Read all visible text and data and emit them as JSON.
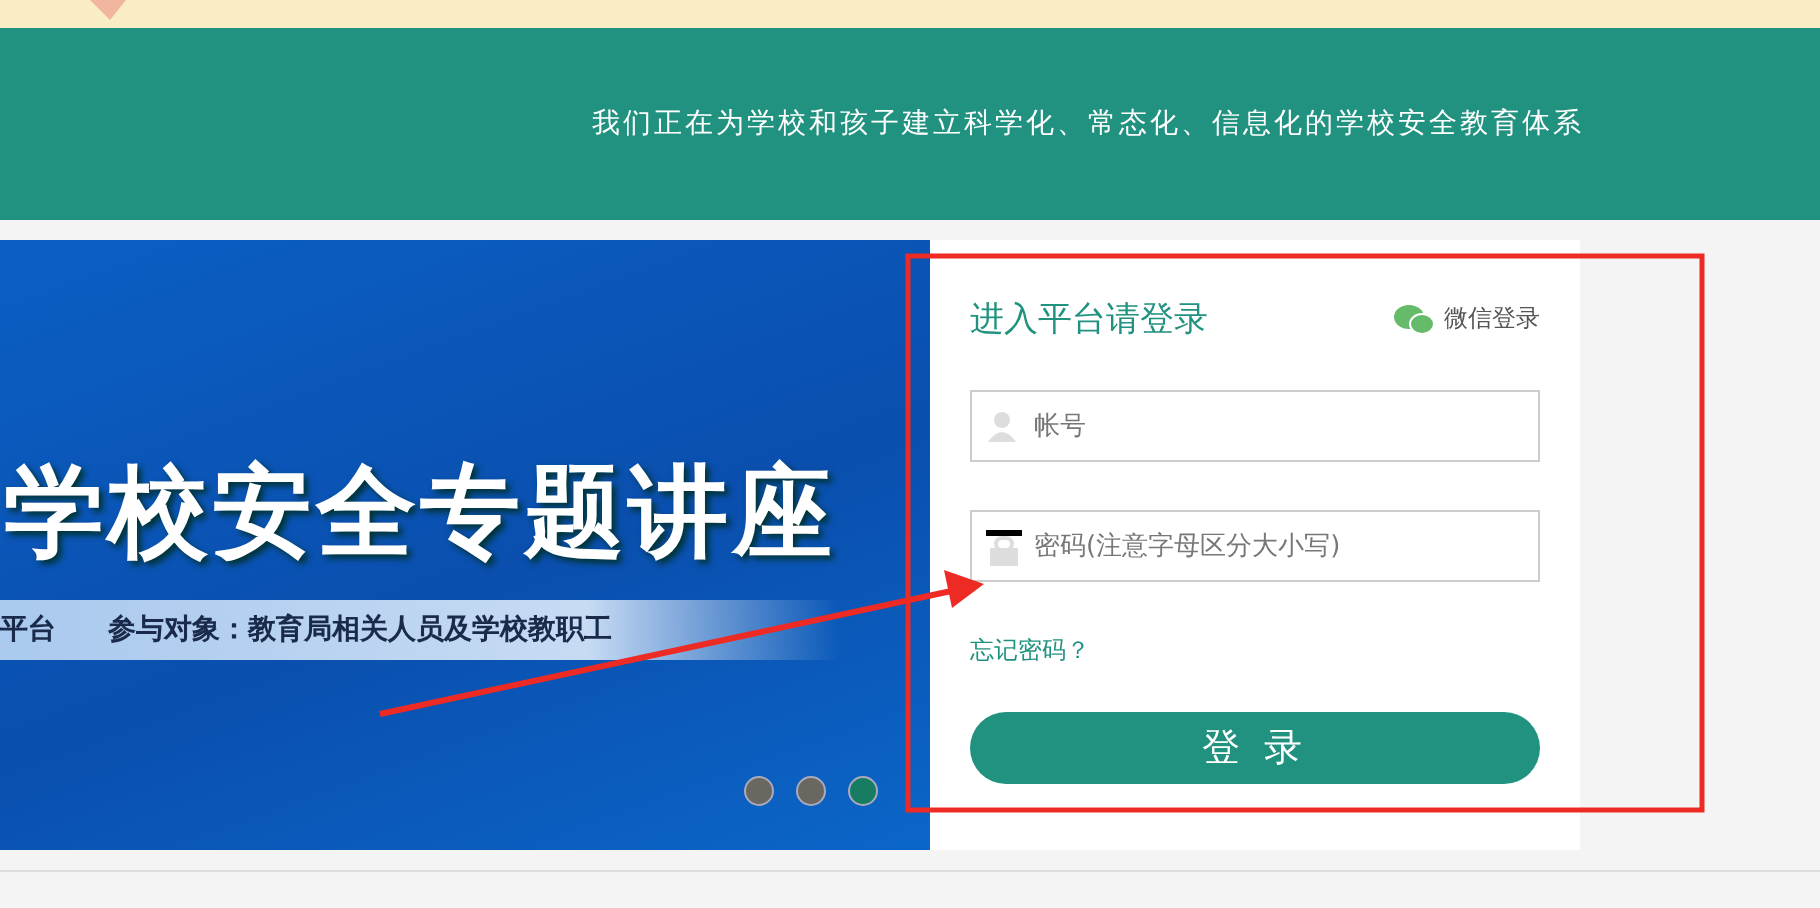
{
  "header": {
    "slogan": "我们正在为学校和孩子建立科学化、常态化、信息化的学校安全教育体系"
  },
  "banner": {
    "title": "学校安全专题讲座",
    "caption_left": "平台",
    "caption_right": "参与对象：教育局相关人员及学校教职工",
    "dots": [
      {
        "selected": false
      },
      {
        "selected": false
      },
      {
        "selected": true
      }
    ]
  },
  "login": {
    "title": "进入平台请登录",
    "wechat_label": "微信登录",
    "account": {
      "placeholder": "帐号"
    },
    "password": {
      "placeholder": "密码(注意字母区分大小写)"
    },
    "forgot_link": "忘记密码？",
    "submit": "登 录"
  }
}
